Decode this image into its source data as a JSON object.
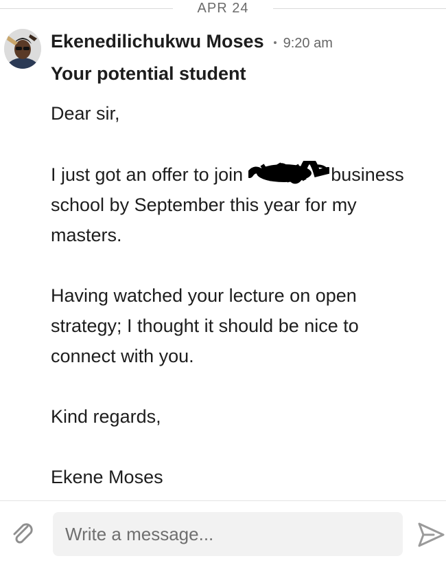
{
  "date_divider": "APR 24",
  "message": {
    "sender": "Ekenedilichukwu Moses",
    "time": "9:20 am",
    "subject": "Your potential student",
    "lines": {
      "greeting": "Dear sir,",
      "p1_l1_pre": "I just got an offer to join",
      "p1_l1_post": "business",
      "p1_l2": "school by September this year for my",
      "p1_l3": "masters.",
      "p2_l1": "Having watched your lecture on open",
      "p2_l2": "strategy; I thought it should be nice to",
      "p2_l3": "connect with you.",
      "closing": "Kind regards,",
      "signature": "Ekene Moses"
    }
  },
  "composer": {
    "placeholder": "Write a message..."
  },
  "icons": {
    "attach": "paperclip-icon",
    "send": "send-icon",
    "avatar": "profile-photo"
  },
  "colors": {
    "text": "#1d1d1d",
    "muted": "#6b6b6b",
    "input_bg": "#f2f2f2",
    "icon": "#9a9a9a"
  }
}
